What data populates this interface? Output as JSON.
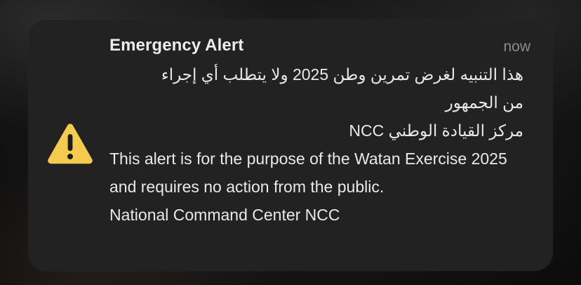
{
  "notification": {
    "title": "Emergency Alert",
    "time": "now",
    "icon": "warning-triangle-icon",
    "arabic_message_line1": "هذا التنبيه لغرض تمرين وطن 2025 ولا يتطلب أي إجراء",
    "arabic_message_line2": "من الجمهور",
    "arabic_sender": "مركز القيادة الوطني NCC",
    "english_message": "This alert is for the purpose of the Watan Exercise 2025 and requires no action from the public.",
    "english_sender": "National Command Center NCC"
  },
  "colors": {
    "card_background": "#222222",
    "icon_fill": "#f4cb4f",
    "title_text": "#ececec",
    "time_text": "#8b8b8b"
  }
}
